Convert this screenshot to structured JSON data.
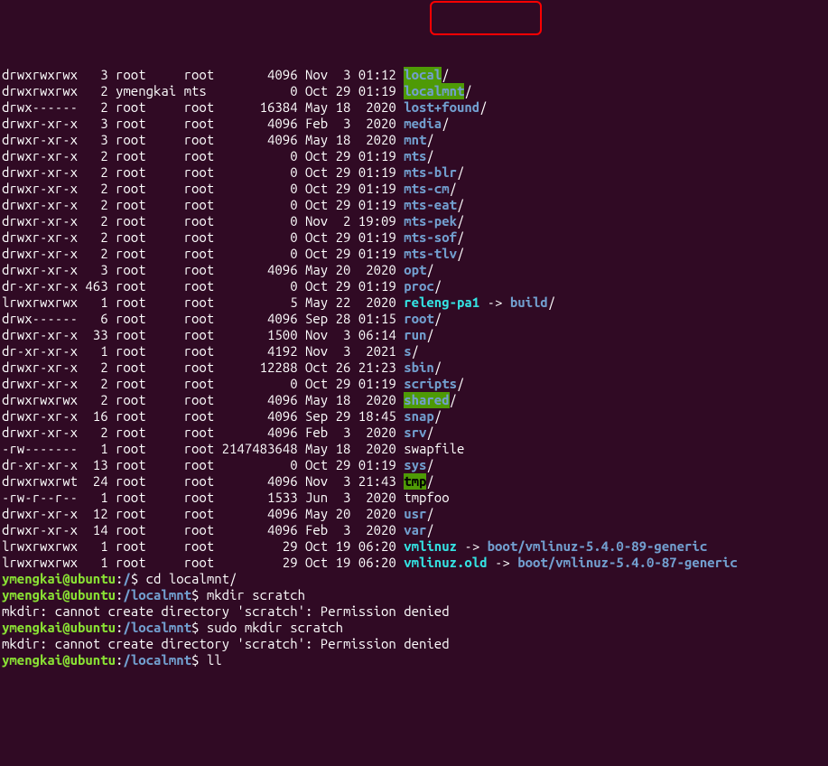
{
  "listing": [
    {
      "perms": "drwxrwxrwx",
      "links": "3",
      "owner": "root",
      "group": "root",
      "size": "4096",
      "date": "Nov  3 01:12",
      "name": "local",
      "suffix": "/",
      "type": "highlight"
    },
    {
      "perms": "drwxrwxrwx",
      "links": "2",
      "owner": "ymengkai",
      "group": "mts",
      "size": "0",
      "date": "Oct 29 01:19",
      "name": "localmnt",
      "suffix": "/",
      "type": "highlight"
    },
    {
      "perms": "drwx------",
      "links": "2",
      "owner": "root",
      "group": "root",
      "size": "16384",
      "date": "May 18  2020",
      "name": "lost+found",
      "suffix": "/",
      "type": "dir"
    },
    {
      "perms": "drwxr-xr-x",
      "links": "3",
      "owner": "root",
      "group": "root",
      "size": "4096",
      "date": "Feb  3  2020",
      "name": "media",
      "suffix": "/",
      "type": "dir"
    },
    {
      "perms": "drwxr-xr-x",
      "links": "3",
      "owner": "root",
      "group": "root",
      "size": "4096",
      "date": "May 18  2020",
      "name": "mnt",
      "suffix": "/",
      "type": "dir"
    },
    {
      "perms": "drwxr-xr-x",
      "links": "2",
      "owner": "root",
      "group": "root",
      "size": "0",
      "date": "Oct 29 01:19",
      "name": "mts",
      "suffix": "/",
      "type": "dir"
    },
    {
      "perms": "drwxr-xr-x",
      "links": "2",
      "owner": "root",
      "group": "root",
      "size": "0",
      "date": "Oct 29 01:19",
      "name": "mts-blr",
      "suffix": "/",
      "type": "dir"
    },
    {
      "perms": "drwxr-xr-x",
      "links": "2",
      "owner": "root",
      "group": "root",
      "size": "0",
      "date": "Oct 29 01:19",
      "name": "mts-cm",
      "suffix": "/",
      "type": "dir"
    },
    {
      "perms": "drwxr-xr-x",
      "links": "2",
      "owner": "root",
      "group": "root",
      "size": "0",
      "date": "Oct 29 01:19",
      "name": "mts-eat",
      "suffix": "/",
      "type": "dir"
    },
    {
      "perms": "drwxr-xr-x",
      "links": "2",
      "owner": "root",
      "group": "root",
      "size": "0",
      "date": "Nov  2 19:09",
      "name": "mts-pek",
      "suffix": "/",
      "type": "dir"
    },
    {
      "perms": "drwxr-xr-x",
      "links": "2",
      "owner": "root",
      "group": "root",
      "size": "0",
      "date": "Oct 29 01:19",
      "name": "mts-sof",
      "suffix": "/",
      "type": "dir"
    },
    {
      "perms": "drwxr-xr-x",
      "links": "2",
      "owner": "root",
      "group": "root",
      "size": "0",
      "date": "Oct 29 01:19",
      "name": "mts-tlv",
      "suffix": "/",
      "type": "dir"
    },
    {
      "perms": "drwxr-xr-x",
      "links": "3",
      "owner": "root",
      "group": "root",
      "size": "4096",
      "date": "May 20  2020",
      "name": "opt",
      "suffix": "/",
      "type": "dir"
    },
    {
      "perms": "dr-xr-xr-x",
      "links": "463",
      "owner": "root",
      "group": "root",
      "size": "0",
      "date": "Oct 29 01:19",
      "name": "proc",
      "suffix": "/",
      "type": "dir"
    },
    {
      "perms": "lrwxrwxrwx",
      "links": "1",
      "owner": "root",
      "group": "root",
      "size": "5",
      "date": "May 22  2020",
      "name": "releng-pa1",
      "arrow": " -> ",
      "target": "build",
      "suffix": "/",
      "type": "link"
    },
    {
      "perms": "drwx------",
      "links": "6",
      "owner": "root",
      "group": "root",
      "size": "4096",
      "date": "Sep 28 01:15",
      "name": "root",
      "suffix": "/",
      "type": "dir"
    },
    {
      "perms": "drwxr-xr-x",
      "links": "33",
      "owner": "root",
      "group": "root",
      "size": "1500",
      "date": "Nov  3 06:14",
      "name": "run",
      "suffix": "/",
      "type": "dir"
    },
    {
      "perms": "dr-xr-xr-x",
      "links": "1",
      "owner": "root",
      "group": "root",
      "size": "4192",
      "date": "Nov  3  2021",
      "name": "s",
      "suffix": "/",
      "type": "dir"
    },
    {
      "perms": "drwxr-xr-x",
      "links": "2",
      "owner": "root",
      "group": "root",
      "size": "12288",
      "date": "Oct 26 21:23",
      "name": "sbin",
      "suffix": "/",
      "type": "dir"
    },
    {
      "perms": "drwxr-xr-x",
      "links": "2",
      "owner": "root",
      "group": "root",
      "size": "0",
      "date": "Oct 29 01:19",
      "name": "scripts",
      "suffix": "/",
      "type": "dir"
    },
    {
      "perms": "drwxrwxrwx",
      "links": "2",
      "owner": "root",
      "group": "root",
      "size": "4096",
      "date": "May 18  2020",
      "name": "shared",
      "suffix": "/",
      "type": "highlight"
    },
    {
      "perms": "drwxr-xr-x",
      "links": "16",
      "owner": "root",
      "group": "root",
      "size": "4096",
      "date": "Sep 29 18:45",
      "name": "snap",
      "suffix": "/",
      "type": "dir"
    },
    {
      "perms": "drwxr-xr-x",
      "links": "2",
      "owner": "root",
      "group": "root",
      "size": "4096",
      "date": "Feb  3  2020",
      "name": "srv",
      "suffix": "/",
      "type": "dir"
    },
    {
      "perms": "-rw-------",
      "links": "1",
      "owner": "root",
      "group": "root",
      "size": "2147483648",
      "date": "May 18  2020",
      "name": "swapfile",
      "suffix": "",
      "type": "file"
    },
    {
      "perms": "dr-xr-xr-x",
      "links": "13",
      "owner": "root",
      "group": "root",
      "size": "0",
      "date": "Oct 29 01:19",
      "name": "sys",
      "suffix": "/",
      "type": "dir"
    },
    {
      "perms": "drwxrwxrwt",
      "links": "24",
      "owner": "root",
      "group": "root",
      "size": "4096",
      "date": "Nov  3 21:43",
      "name": "tmp",
      "suffix": "/",
      "type": "sticky"
    },
    {
      "perms": "-rw-r--r--",
      "links": "1",
      "owner": "root",
      "group": "root",
      "size": "1533",
      "date": "Jun  3  2020",
      "name": "tmpfoo",
      "suffix": "",
      "type": "file"
    },
    {
      "perms": "drwxr-xr-x",
      "links": "12",
      "owner": "root",
      "group": "root",
      "size": "4096",
      "date": "May 20  2020",
      "name": "usr",
      "suffix": "/",
      "type": "dir"
    },
    {
      "perms": "drwxr-xr-x",
      "links": "14",
      "owner": "root",
      "group": "root",
      "size": "4096",
      "date": "Feb  3  2020",
      "name": "var",
      "suffix": "/",
      "type": "dir"
    },
    {
      "perms": "lrwxrwxrwx",
      "links": "1",
      "owner": "root",
      "group": "root",
      "size": "29",
      "date": "Oct 19 06:20",
      "name": "vmlinuz",
      "arrow": " -> ",
      "target": "boot/vmlinuz-5.4.0-89-generic",
      "suffix": "",
      "type": "link"
    },
    {
      "perms": "lrwxrwxrwx",
      "links": "1",
      "owner": "root",
      "group": "root",
      "size": "29",
      "date": "Oct 19 06:20",
      "name": "vmlinuz.old",
      "arrow": " -> ",
      "target": "boot/vmlinuz-5.4.0-87-generic",
      "suffix": "",
      "type": "link"
    }
  ],
  "prompts": [
    {
      "user": "ymengkai@ubuntu",
      "sep": ":",
      "path": "/",
      "dollar": "$ ",
      "cmd": "cd localmnt/"
    },
    {
      "user": "ymengkai@ubuntu",
      "sep": ":",
      "path": "/localmnt",
      "dollar": "$ ",
      "cmd": "mkdir scratch"
    },
    {
      "output": "mkdir: cannot create directory 'scratch': Permission denied"
    },
    {
      "user": "ymengkai@ubuntu",
      "sep": ":",
      "path": "/localmnt",
      "dollar": "$ ",
      "cmd": "sudo mkdir scratch"
    },
    {
      "output": "mkdir: cannot create directory 'scratch': Permission denied"
    },
    {
      "user": "ymengkai@ubuntu",
      "sep": ":",
      "path": "/localmnt",
      "dollar": "$ ",
      "cmd": "ll"
    }
  ]
}
